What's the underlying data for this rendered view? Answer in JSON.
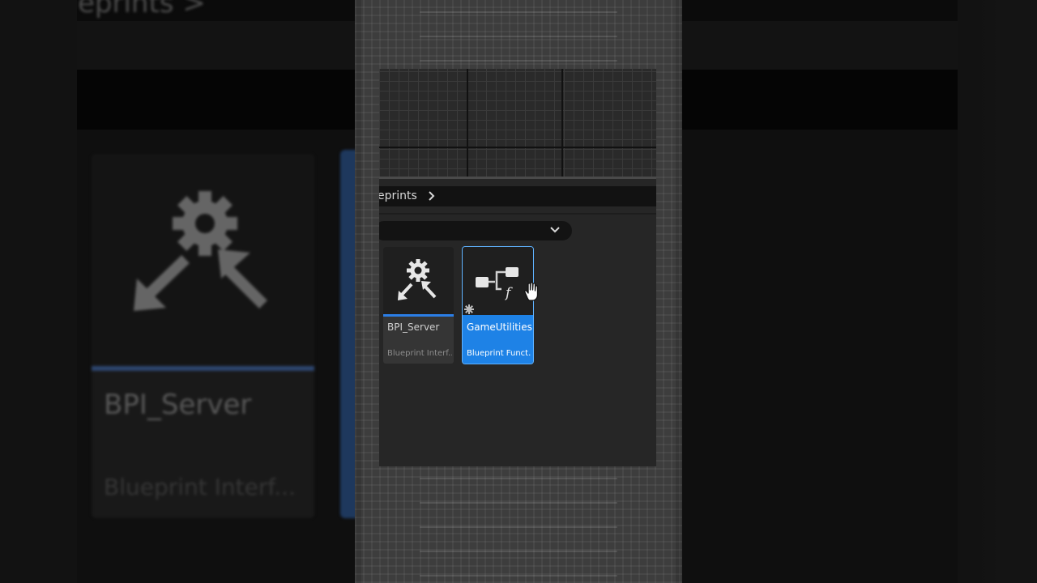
{
  "background": {
    "title_fragment": "eprints  >",
    "card_name": "BPI_Server",
    "card_type": "Blueprint Interf..."
  },
  "path_bar": {
    "text": "eprints"
  },
  "assets": [
    {
      "name": "BPI_Server",
      "type": "Blueprint Interf...",
      "icon": "interface-icon",
      "selected": false
    },
    {
      "name": "GameUtilities",
      "type": "Blueprint Funct...",
      "icon": "function-library-icon",
      "selected": true
    }
  ],
  "colors": {
    "selection": "#1e82e6",
    "accent_strip": "#2b7ee6",
    "panel": "#262626"
  }
}
